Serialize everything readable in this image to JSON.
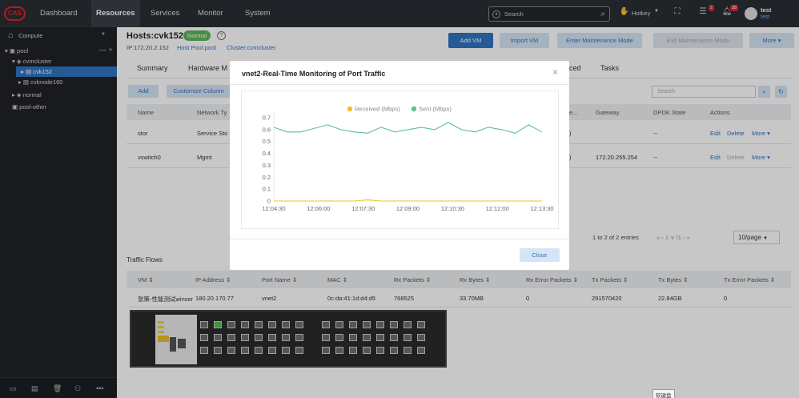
{
  "topbar": {
    "logo": "CAS",
    "nav": [
      "Dashboard",
      "Resources",
      "Services",
      "Monitor",
      "System"
    ],
    "search_placeholder": "Search",
    "hotkey": "Hotkey",
    "badge_messages": "2",
    "badge_alarms": "38",
    "user_name": "test",
    "user_sub": "test"
  },
  "sidebar": {
    "compute": "Compute",
    "pool": "pool",
    "cvmcluster": "cvmcluster",
    "cvk152": "cvk152",
    "cvknode160": "cvknode160",
    "normal": "normal",
    "pool_other": "pool-other",
    "add_remove": "— +"
  },
  "host": {
    "title": "Hosts:cvk152",
    "status": "Normal",
    "ip": "IP:172.20.2.152",
    "pool": "Host Pool:pool",
    "cluster": "Cluster:cvmcluster",
    "actions": [
      "Add VM",
      "Import VM",
      "Enter Maintenance Mode",
      "Exit Maintenance Mode",
      "More"
    ]
  },
  "tabs": [
    "Summary",
    "Hardware M",
    "ced",
    "Tasks"
  ],
  "vswitch": {
    "add": "Add",
    "customize": "Customize Column",
    "search_placeholder": "Search",
    "headers": [
      "Name",
      "Network Ty",
      "e...",
      "Gateway",
      "DPDK State",
      "Actions"
    ],
    "rows": [
      {
        "name": "stor",
        "type": "Service Sto",
        "mid": ")",
        "gateway": "--",
        "dpdk": "",
        "edit": "Edit",
        "delete": "Delete",
        "more": "More"
      },
      {
        "name": "vswitch0",
        "type": "Mgmt",
        "mid": ")",
        "gateway": "172.20.255.254",
        "dpdk": "--",
        "edit": "Edit",
        "delete": "Delete",
        "more": "More"
      }
    ],
    "pager_text": "1 to 2 of 2 entries",
    "pager_nav": "«  ‹  1 ∨ /1  ›  »",
    "page_size": "10/page"
  },
  "traffic": {
    "title": "Traffic Flows",
    "headers": [
      "VM",
      "IP Address",
      "Port Name",
      "MAC",
      "Rx Packets",
      "Rx Bytes",
      "Rx Error Packets",
      "Tx Packets",
      "Tx Bytes",
      "Tx Error Packets"
    ],
    "row": [
      "张策-性能测试winser",
      "180.20.170.77",
      "vnet2",
      "0c:da:41:1d:d4:d5",
      "768525",
      "33.70MB",
      "0",
      "291570420",
      "22.84GB",
      "0"
    ]
  },
  "modal": {
    "title": "vnet2-Real-Time Monitoring of Port Traffic",
    "close": "Close"
  },
  "chart_data": {
    "type": "line",
    "title": "",
    "xlabel": "",
    "ylabel": "",
    "x": [
      "12:04:30",
      "12:06:00",
      "12:07:30",
      "12:09:00",
      "12:10:30",
      "12:12:00",
      "12:13:30"
    ],
    "ylim": [
      0,
      0.7
    ],
    "yticks": [
      "0",
      "0.1",
      "0.2",
      "0.3",
      "0.4",
      "0.5",
      "0.6",
      "0.7"
    ],
    "legend_position": "top",
    "series": [
      {
        "name": "Received (Mbps)",
        "color": "#f2c12e",
        "values": [
          0.0,
          0.0,
          0.0,
          0.0,
          0.0,
          0.0,
          0.0,
          0.01,
          0.0,
          0.0,
          0.0,
          0.0,
          0.0,
          0.0,
          0.0,
          0.0,
          0.0,
          0.0,
          0.0,
          0.0,
          0.0
        ]
      },
      {
        "name": "Sent (Mbps)",
        "color": "#5cc48a",
        "values": [
          0.62,
          0.58,
          0.58,
          0.61,
          0.64,
          0.6,
          0.58,
          0.57,
          0.62,
          0.58,
          0.6,
          0.62,
          0.6,
          0.66,
          0.6,
          0.58,
          0.62,
          0.6,
          0.57,
          0.64,
          0.58
        ]
      }
    ]
  },
  "tooltip": "软键盘"
}
